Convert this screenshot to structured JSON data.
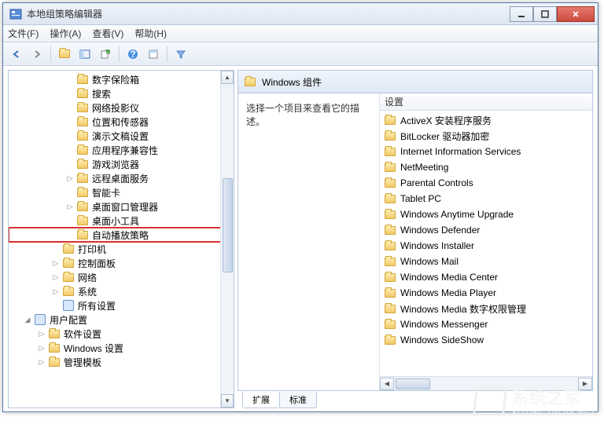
{
  "window": {
    "title": "本地组策略编辑器"
  },
  "menu": {
    "file": "文件(F)",
    "action": "操作(A)",
    "view": "查看(V)",
    "help": "帮助(H)"
  },
  "tree": {
    "items": [
      {
        "label": "数字保险箱",
        "indent": 4,
        "expander": ""
      },
      {
        "label": "搜索",
        "indent": 4,
        "expander": ""
      },
      {
        "label": "网络投影仪",
        "indent": 4,
        "expander": ""
      },
      {
        "label": "位置和传感器",
        "indent": 4,
        "expander": ""
      },
      {
        "label": "演示文稿设置",
        "indent": 4,
        "expander": ""
      },
      {
        "label": "应用程序兼容性",
        "indent": 4,
        "expander": ""
      },
      {
        "label": "游戏浏览器",
        "indent": 4,
        "expander": ""
      },
      {
        "label": "远程桌面服务",
        "indent": 4,
        "expander": "▷"
      },
      {
        "label": "智能卡",
        "indent": 4,
        "expander": ""
      },
      {
        "label": "桌面窗口管理器",
        "indent": 4,
        "expander": "▷"
      },
      {
        "label": "桌面小工具",
        "indent": 4,
        "expander": ""
      },
      {
        "label": "自动播放策略",
        "indent": 4,
        "expander": "",
        "highlight": true
      },
      {
        "label": "打印机",
        "indent": 3,
        "expander": ""
      },
      {
        "label": "控制面板",
        "indent": 3,
        "expander": "▷"
      },
      {
        "label": "网络",
        "indent": 3,
        "expander": "▷"
      },
      {
        "label": "系统",
        "indent": 3,
        "expander": "▷"
      },
      {
        "label": "所有设置",
        "indent": 3,
        "expander": "",
        "special": true
      },
      {
        "label": "用户配置",
        "indent": 1,
        "expander": "◢",
        "special": true
      },
      {
        "label": "软件设置",
        "indent": 2,
        "expander": "▷"
      },
      {
        "label": "Windows 设置",
        "indent": 2,
        "expander": "▷"
      },
      {
        "label": "管理模板",
        "indent": 2,
        "expander": "▷"
      }
    ]
  },
  "right": {
    "header": "Windows 组件",
    "description": "选择一个项目来查看它的描述。",
    "column_header": "设置",
    "items": [
      "ActiveX 安装程序服务",
      "BitLocker 驱动器加密",
      "Internet Information Services",
      "NetMeeting",
      "Parental Controls",
      "Tablet PC",
      "Windows Anytime Upgrade",
      "Windows Defender",
      "Windows Installer",
      "Windows Mail",
      "Windows Media Center",
      "Windows Media Player",
      "Windows Media 数字权限管理",
      "Windows Messenger",
      "Windows SideShow"
    ],
    "tabs": {
      "extended": "扩展",
      "standard": "标准"
    }
  },
  "watermark": {
    "text": "系统之家",
    "url": "XITONGZHIJIA.NET"
  }
}
